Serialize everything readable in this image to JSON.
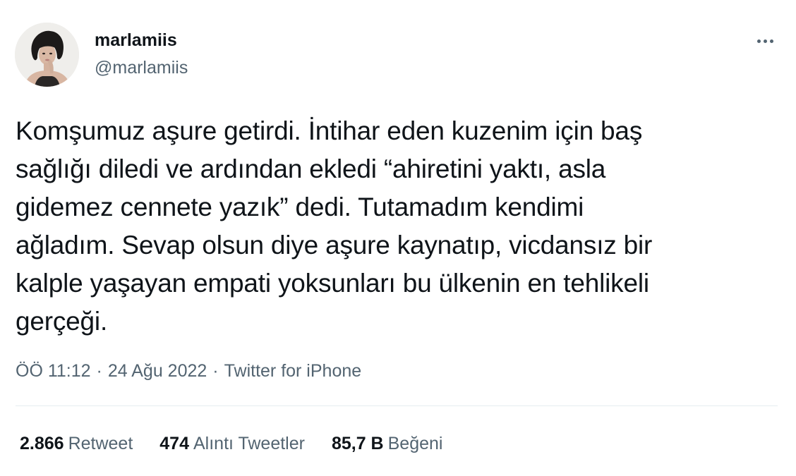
{
  "author": {
    "display_name": "marlamiis",
    "handle": "@marlamiis",
    "avatar_icon": "profile-photo"
  },
  "menu": {
    "icon": "more-horizontal-icon"
  },
  "tweet": {
    "lines": [
      "Komşumuz aşure getirdi. İntihar eden kuzenim için baş",
      "sağlığı diledi ve ardından ekledi “ahiretini yaktı, asla",
      "gidemez cennete yazık” dedi. Tutamadım kendimi",
      "ağladım. Sevap olsun diye aşure kaynatıp, vicdansız bir",
      "kalple yaşayan empati yoksunları bu ülkenin en tehlikeli",
      "gerçeği."
    ]
  },
  "meta": {
    "time": "ÖÖ 11:12",
    "separator": "·",
    "date": "24 Ağu 2022",
    "source": "Twitter for iPhone"
  },
  "stats": {
    "retweets": {
      "count": "2.866",
      "label": "Retweet"
    },
    "quotes": {
      "count": "474",
      "label": "Alıntı Tweetler"
    },
    "likes": {
      "count": "85,7 B",
      "label": "Beğeni"
    }
  },
  "colors": {
    "text": "#0f1419",
    "secondary": "#536471",
    "divider": "#e6ecf0"
  }
}
